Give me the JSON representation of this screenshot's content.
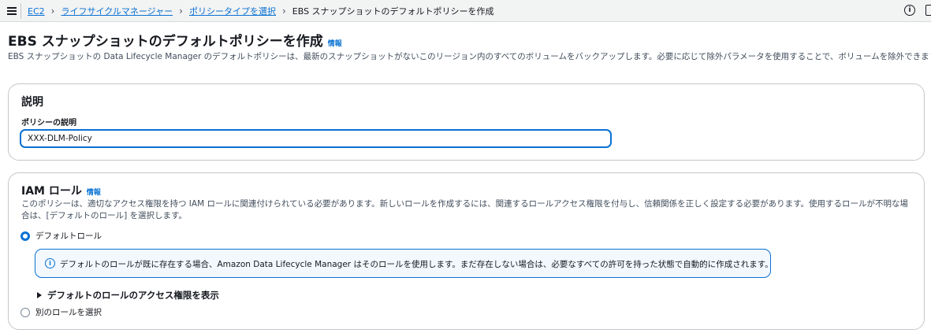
{
  "breadcrumb": {
    "items": [
      "EC2",
      "ライフサイクルマネージャー",
      "ポリシータイプを選択"
    ],
    "current": "EBS スナップショットのデフォルトポリシーを作成",
    "separator": "›"
  },
  "header": {
    "title": "EBS スナップショットのデフォルトポリシーを作成",
    "info_link": "情報",
    "description": "EBS スナップショットの Data Lifecycle Manager のデフォルトポリシーは、最新のスナップショットがないこのリージョン内のすべてのボリュームをバックアップします。必要に応じて除外パラメータを使用することで、ボリュームを除外できます。"
  },
  "description_section": {
    "heading": "説明",
    "field_label": "ポリシーの説明",
    "field_value": "XXX-DLM-Policy"
  },
  "iam_section": {
    "heading": "IAM ロール",
    "info_link": "情報",
    "description": "このポリシーは、適切なアクセス権限を持つ IAM ロールに関連付けられている必要があります。新しいロールを作成するには、関連するロールアクセス権限を付与し、信頼関係を正しく設定する必要があります。使用するロールが不明な場合は、[デフォルトのロール] を選択します。",
    "option_default": "デフォルトロール",
    "option_default_selected": true,
    "alert_text": "デフォルトのロールが既に存在する場合、Amazon Data Lifecycle Manager はそのロールを使用します。まだ存在しない場合は、必要なすべての許可を持った状態で自動的に作成されます。",
    "expander_label": "デフォルトのロールのアクセス権限を表示",
    "option_other": "別のロールを選択"
  },
  "icons": {
    "menu": "hamburger-menu-icon",
    "info": "info-icon",
    "panel": "side-panel-icon"
  },
  "colors": {
    "link": "#0972d3",
    "alert_bg": "#f2f8fd"
  }
}
